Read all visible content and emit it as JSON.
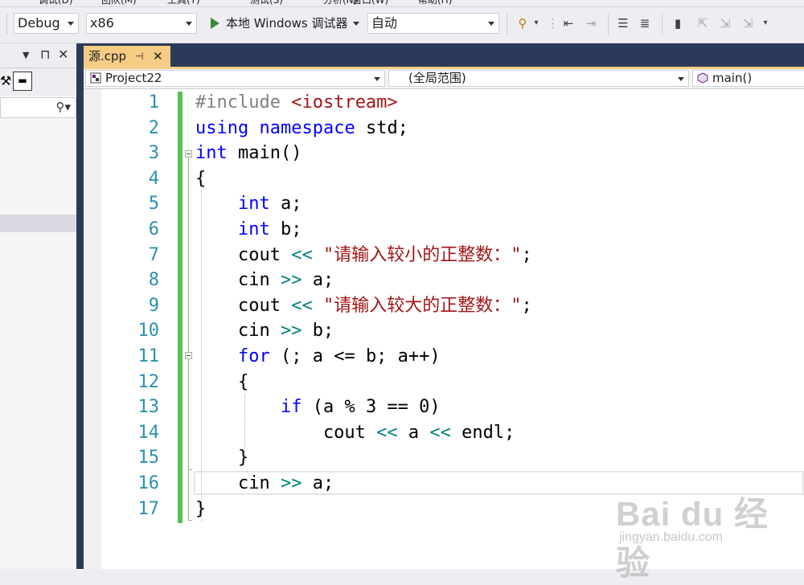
{
  "menu": {
    "items": [
      "调试(D)",
      "团队(M)",
      "工具(T)",
      "测试(S)",
      "分析(N)",
      "窗口(W)",
      "帮助(H)"
    ]
  },
  "toolbar": {
    "config": "Debug",
    "platform": "x86",
    "run_label": "本地 Windows 调试器",
    "run_mode": "自动"
  },
  "left_panel": {
    "pin_glyph": "⊓",
    "close_glyph": "✕"
  },
  "tab": {
    "title": "源.cpp",
    "pin_glyph": "⊣",
    "close_glyph": "✕"
  },
  "navbar": {
    "project": "Project22",
    "scope": "(全局范围)",
    "member": "main()"
  },
  "code": {
    "line_numbers": [
      "1",
      "2",
      "3",
      "4",
      "5",
      "6",
      "7",
      "8",
      "9",
      "10",
      "11",
      "12",
      "13",
      "14",
      "15",
      "16",
      "17"
    ],
    "lines": [
      [
        {
          "t": "#include ",
          "c": "pp"
        },
        {
          "t": "<iostream>",
          "c": "inc"
        }
      ],
      [
        {
          "t": "using",
          "c": "kw"
        },
        {
          "t": " ",
          "c": ""
        },
        {
          "t": "namespace",
          "c": "kw"
        },
        {
          "t": " std;",
          "c": ""
        }
      ],
      [
        {
          "t": "int",
          "c": "kw"
        },
        {
          "t": " main()",
          "c": ""
        }
      ],
      [
        {
          "t": "{",
          "c": ""
        }
      ],
      [
        {
          "t": "    ",
          "c": ""
        },
        {
          "t": "int",
          "c": "kw"
        },
        {
          "t": " a;",
          "c": ""
        }
      ],
      [
        {
          "t": "    ",
          "c": ""
        },
        {
          "t": "int",
          "c": "kw"
        },
        {
          "t": " b;",
          "c": ""
        }
      ],
      [
        {
          "t": "    cout ",
          "c": ""
        },
        {
          "t": "<<",
          "c": "op"
        },
        {
          "t": " ",
          "c": ""
        },
        {
          "t": "\"请输入较小的正整数：\"",
          "c": "str"
        },
        {
          "t": ";",
          "c": ""
        }
      ],
      [
        {
          "t": "    cin ",
          "c": ""
        },
        {
          "t": ">>",
          "c": "op"
        },
        {
          "t": " a;",
          "c": ""
        }
      ],
      [
        {
          "t": "    cout ",
          "c": ""
        },
        {
          "t": "<<",
          "c": "op"
        },
        {
          "t": " ",
          "c": ""
        },
        {
          "t": "\"请输入较大的正整数：\"",
          "c": "str"
        },
        {
          "t": ";",
          "c": ""
        }
      ],
      [
        {
          "t": "    cin ",
          "c": ""
        },
        {
          "t": ">>",
          "c": "op"
        },
        {
          "t": " b;",
          "c": ""
        }
      ],
      [
        {
          "t": "    ",
          "c": ""
        },
        {
          "t": "for",
          "c": "kw"
        },
        {
          "t": " (; a <= b; a++)",
          "c": ""
        }
      ],
      [
        {
          "t": "    {",
          "c": ""
        }
      ],
      [
        {
          "t": "        ",
          "c": ""
        },
        {
          "t": "if",
          "c": "kw"
        },
        {
          "t": " (a % 3 == 0)",
          "c": ""
        }
      ],
      [
        {
          "t": "            cout ",
          "c": ""
        },
        {
          "t": "<<",
          "c": "op"
        },
        {
          "t": " a ",
          "c": ""
        },
        {
          "t": "<<",
          "c": "op"
        },
        {
          "t": " endl;",
          "c": ""
        }
      ],
      [
        {
          "t": "    }",
          "c": ""
        }
      ],
      [
        {
          "t": "    cin ",
          "c": ""
        },
        {
          "t": ">>",
          "c": "op"
        },
        {
          "t": " a;",
          "c": ""
        }
      ],
      [
        {
          "t": "}",
          "c": ""
        }
      ]
    ]
  },
  "watermark": {
    "logo": "Bai du 经验",
    "url": "jingyan.baidu.com"
  },
  "colors": {
    "tab_active": "#f5cc84",
    "change_bar": "#57c157",
    "keyword": "#0000ff",
    "string": "#a31515",
    "line_number": "#2b91af"
  }
}
